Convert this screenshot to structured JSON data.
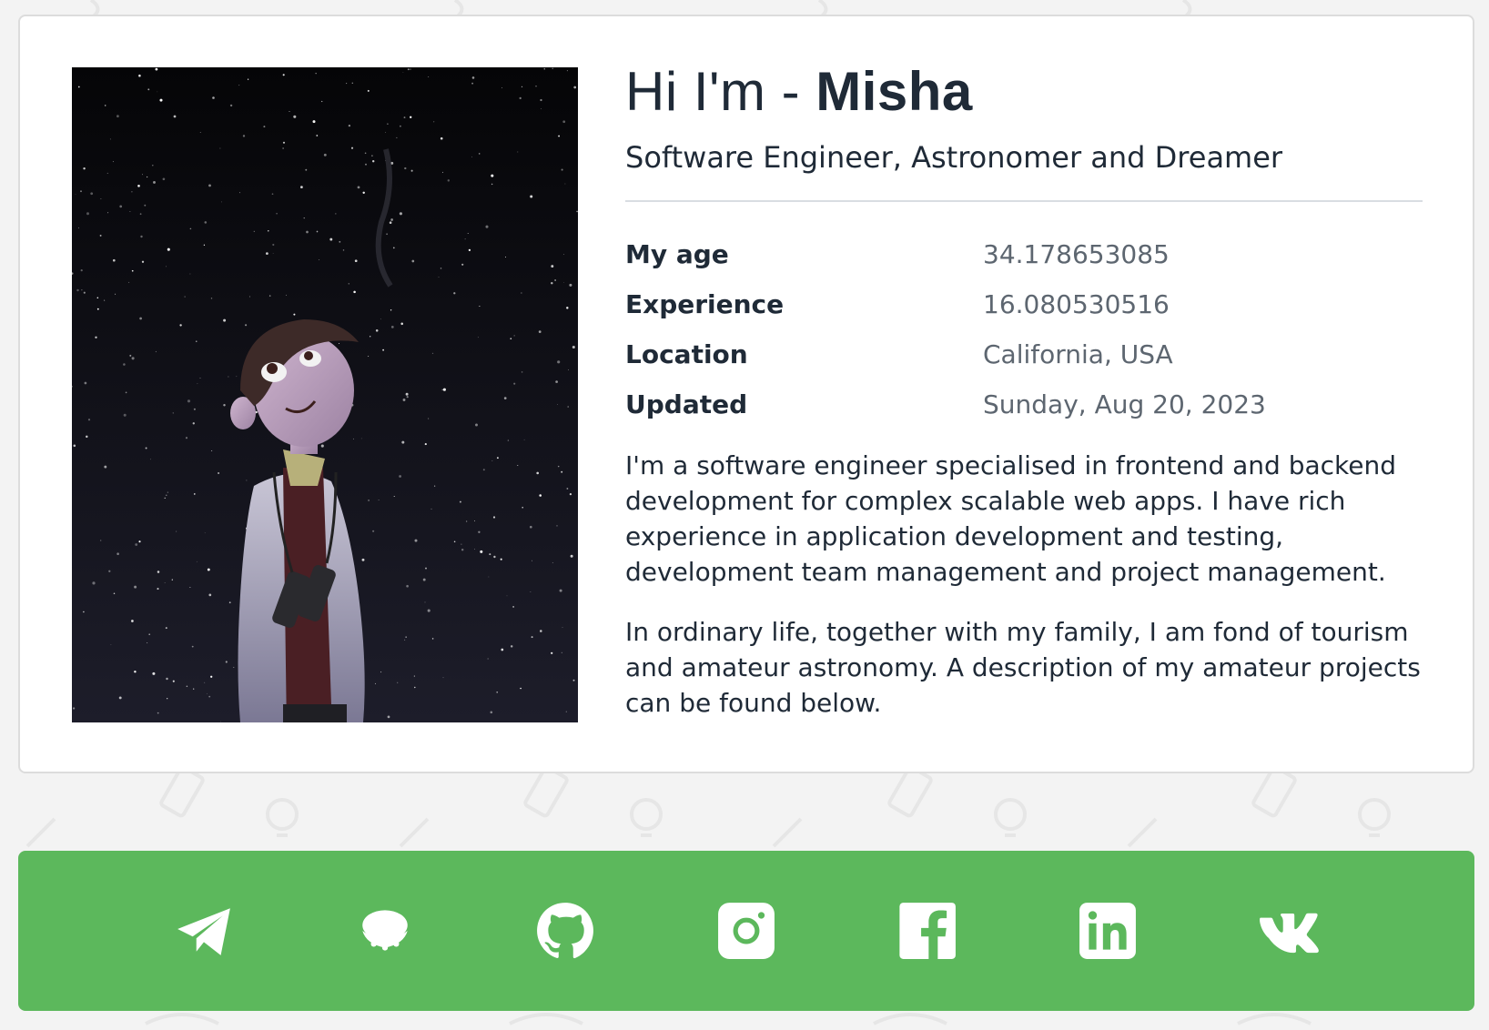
{
  "profile": {
    "greeting_prefix": "Hi I'm - ",
    "name": "Misha",
    "subtitle": "Software Engineer, Astronomer and Dreamer",
    "photo_alt": "Illustration of Misha looking at the starry sky"
  },
  "facts": [
    {
      "label": "My age",
      "value": "34.178653085"
    },
    {
      "label": "Experience",
      "value": "16.080530516"
    },
    {
      "label": "Location",
      "value": "California, USA"
    },
    {
      "label": "Updated",
      "value": "Sunday, Aug 20, 2023"
    }
  ],
  "bio": [
    "I'm a software engineer specialised in frontend and backend development for complex scalable web apps. I have rich experience in application development and testing, development team management and project management.",
    "In ordinary life, together with my family, I am fond of tourism and amateur astronomy. A description of my amateur projects can be found below."
  ],
  "social": [
    {
      "name": "telegram",
      "icon": "telegram-icon"
    },
    {
      "name": "ufo",
      "icon": "ufo-icon"
    },
    {
      "name": "github",
      "icon": "github-icon"
    },
    {
      "name": "instagram",
      "icon": "instagram-icon"
    },
    {
      "name": "facebook",
      "icon": "facebook-icon"
    },
    {
      "name": "linkedin",
      "icon": "linkedin-icon"
    },
    {
      "name": "vk",
      "icon": "vk-icon"
    }
  ],
  "colors": {
    "social_bar": "#5cb85c",
    "text_dark": "#1f2a37",
    "text_muted": "#5d6670",
    "background": "#f3f3f3"
  }
}
